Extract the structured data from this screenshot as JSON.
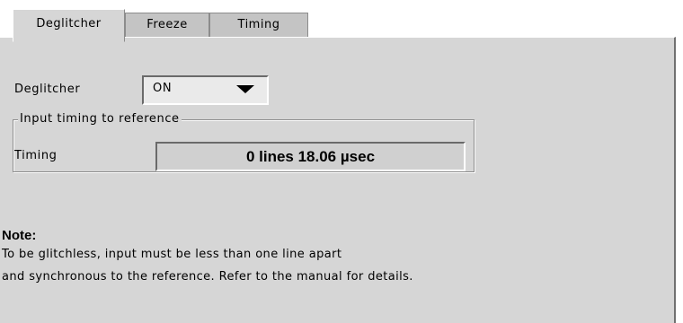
{
  "tabs": [
    {
      "label": "Deglitcher",
      "active": true
    },
    {
      "label": "Freeze",
      "active": false
    },
    {
      "label": "Timing",
      "active": false
    }
  ],
  "deglitcher": {
    "label": "Deglitcher",
    "value": "ON"
  },
  "input_timing": {
    "group_title": "Input timing to reference",
    "label": "Timing",
    "value": "0 lines 18.06 µsec"
  },
  "note": {
    "title": "Note:",
    "line1": "To be glitchless, input must be less than one line apart",
    "line2": "and synchronous to the reference. Refer to the manual for details."
  },
  "colors": {
    "panel": "#d6d6d6",
    "tab_inactive": "#c4c4c4",
    "background": "#ffffff"
  },
  "icons": {
    "dropdown": "triangle-down"
  }
}
